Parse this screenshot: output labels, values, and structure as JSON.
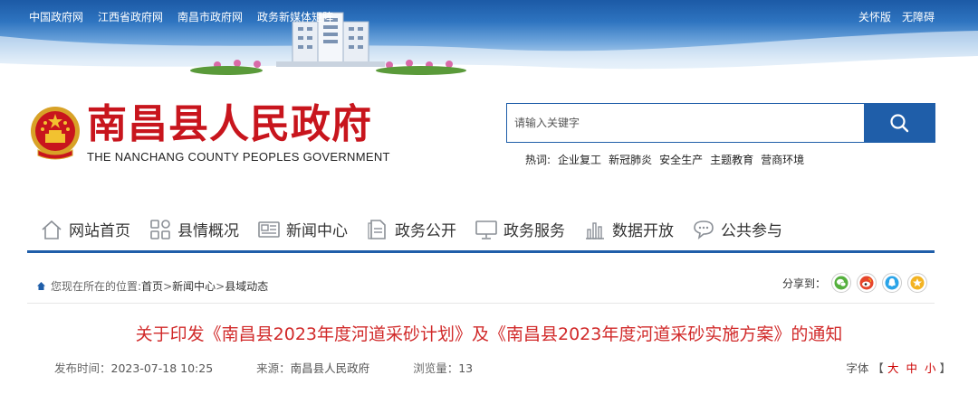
{
  "topbar": {
    "links": [
      "中国政府网",
      "江西省政府网",
      "南昌市政府网",
      "政务新媒体矩阵"
    ],
    "right": [
      "关怀版",
      "无障碍"
    ]
  },
  "header": {
    "title": "南昌县人民政府",
    "subtitle": "THE NANCHANG COUNTY PEOPLES GOVERNMENT"
  },
  "search": {
    "placeholder": "请输入关键字",
    "hot_label": "热词:",
    "hot_words": [
      "企业复工",
      "新冠肺炎",
      "安全生产",
      "主题教育",
      "营商环境"
    ]
  },
  "nav": {
    "items": [
      {
        "label": "网站首页",
        "icon": "home-icon"
      },
      {
        "label": "县情概况",
        "icon": "grid-icon"
      },
      {
        "label": "新闻中心",
        "icon": "newspaper-icon"
      },
      {
        "label": "政务公开",
        "icon": "document-icon"
      },
      {
        "label": "政务服务",
        "icon": "monitor-icon"
      },
      {
        "label": "数据开放",
        "icon": "bar-chart-icon"
      },
      {
        "label": "公共参与",
        "icon": "chat-icon"
      }
    ]
  },
  "breadcrumb": {
    "prefix": "您现在所在的位置:",
    "items": [
      "首页",
      "新闻中心",
      "县域动态"
    ],
    "sep": ">"
  },
  "share": {
    "label": "分享到：",
    "targets": [
      "wechat-icon",
      "weibo-icon",
      "qq-icon",
      "qzone-icon"
    ]
  },
  "article": {
    "title": "关于印发《南昌县2023年度河道采砂计划》及《南昌县2023年度河道采砂实施方案》的通知",
    "publish_label": "发布时间：",
    "publish_time": "2023-07-18 10:25",
    "source_label": "来源：",
    "source": "南昌县人民政府",
    "views_label": "浏览量：",
    "views": "13",
    "font_label": "字体",
    "font_sizes": [
      "大",
      "中",
      "小"
    ]
  },
  "colors": {
    "brand_blue": "#1f5ea9",
    "title_red": "#c8151d",
    "article_red": "#d12a2a"
  }
}
